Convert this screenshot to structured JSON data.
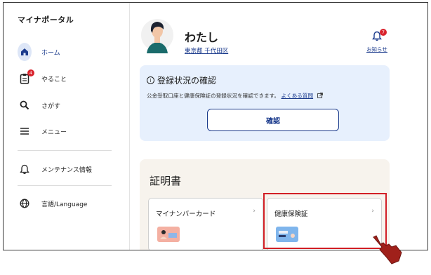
{
  "app": {
    "title": "マイナポータル"
  },
  "sidebar": {
    "items": [
      {
        "label": "ホーム",
        "icon": "home-icon",
        "active": true
      },
      {
        "label": "やること",
        "icon": "clipboard-icon",
        "badge": "4"
      },
      {
        "label": "さがす",
        "icon": "search-icon"
      },
      {
        "label": "メニュー",
        "icon": "menu-icon"
      },
      {
        "label": "メンテナンス情報",
        "icon": "bell-icon"
      },
      {
        "label": "言語/Language",
        "icon": "globe-icon"
      }
    ]
  },
  "profile": {
    "name": "わたし",
    "address": "東京都 千代田区"
  },
  "notice": {
    "label": "お知らせ",
    "badge": "7"
  },
  "registration": {
    "title": "登録状況の確認",
    "description": "公金受取口座と健康保険証の登録状況を確認できます。",
    "faq_link": "よくある質問",
    "button": "確認"
  },
  "certificates": {
    "title": "証明書",
    "cards": [
      {
        "label": "マイナンバーカード",
        "chevron": "›"
      },
      {
        "label": "健康保険証",
        "chevron": "›"
      }
    ]
  },
  "colors": {
    "accent": "#1a3a8c",
    "highlight": "#d21f26",
    "badge": "#d9232d"
  }
}
